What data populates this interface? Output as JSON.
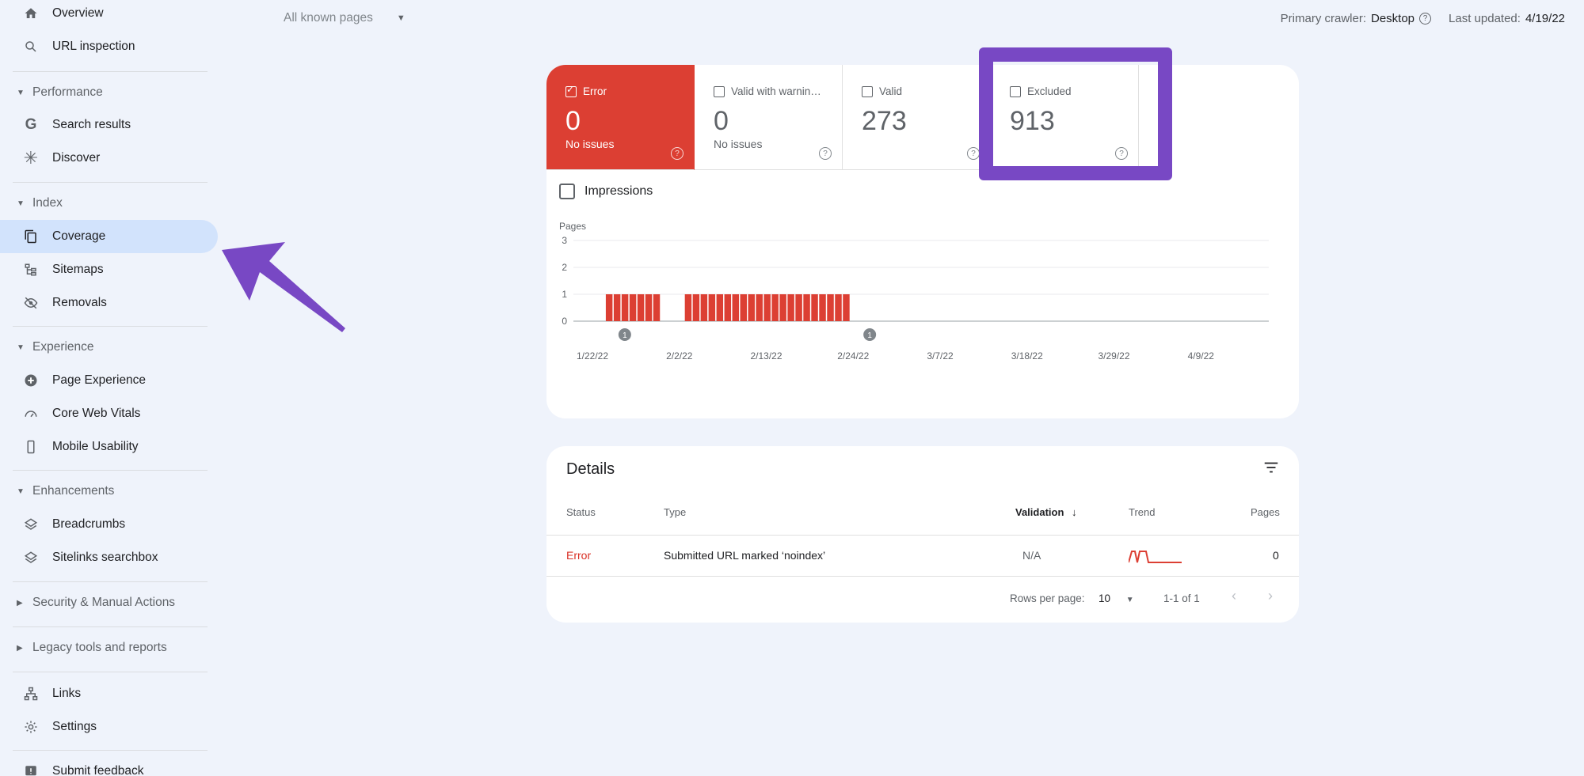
{
  "sidebar": {
    "overview": "Overview",
    "url_inspection": "URL inspection",
    "performance": "Performance",
    "search_results": "Search results",
    "discover": "Discover",
    "index": "Index",
    "coverage": "Coverage",
    "sitemaps": "Sitemaps",
    "removals": "Removals",
    "experience": "Experience",
    "page_experience": "Page Experience",
    "core_web_vitals": "Core Web Vitals",
    "mobile_usability": "Mobile Usability",
    "enhancements": "Enhancements",
    "breadcrumbs": "Breadcrumbs",
    "sitelinks_searchbox": "Sitelinks searchbox",
    "security": "Security & Manual Actions",
    "legacy": "Legacy tools and reports",
    "links": "Links",
    "settings": "Settings",
    "feedback": "Submit feedback"
  },
  "topbar": {
    "filter": "All known pages",
    "crawler_label": "Primary crawler:",
    "crawler_value": "Desktop",
    "updated_label": "Last updated:",
    "updated_value": "4/19/22"
  },
  "tiles": [
    {
      "label": "Error",
      "value": "0",
      "sub": "No issues"
    },
    {
      "label": "Valid with warnin…",
      "value": "0",
      "sub": "No issues"
    },
    {
      "label": "Valid",
      "value": "273",
      "sub": ""
    },
    {
      "label": "Excluded",
      "value": "913",
      "sub": ""
    }
  ],
  "impressions_label": "Impressions",
  "chart_data": {
    "type": "bar",
    "ylabel": "Pages",
    "ylim": [
      0,
      3
    ],
    "yticks": [
      "0",
      "1",
      "2",
      "3"
    ],
    "xtick_labels": [
      "1/22/22",
      "2/2/22",
      "2/13/22",
      "2/24/22",
      "3/7/22",
      "3/18/22",
      "3/29/22",
      "4/9/22"
    ],
    "annotation_label": "1",
    "color": "#dc3f33",
    "series": [
      {
        "start_day": 4,
        "values": [
          1,
          1,
          1,
          1,
          1,
          1,
          1
        ]
      },
      {
        "start_day": 14,
        "values": [
          1,
          1,
          1,
          1,
          1,
          1,
          1,
          1,
          1,
          1,
          1,
          1,
          1,
          1,
          1,
          1,
          1,
          1,
          1,
          1,
          1
        ]
      }
    ]
  },
  "details": {
    "title": "Details",
    "headers": {
      "status": "Status",
      "type": "Type",
      "validation": "Validation",
      "trend": "Trend",
      "pages": "Pages"
    },
    "row": {
      "status": "Error",
      "type": "Submitted URL marked ‘noindex’",
      "validation": "N/A",
      "pages": "0"
    },
    "rows_per_page_label": "Rows per page:",
    "rows_per_page": "10",
    "range": "1-1 of 1"
  },
  "colors": {
    "error": "#dc3f33",
    "highlight": "#7848c4",
    "active_nav": "#d2e3fc"
  }
}
